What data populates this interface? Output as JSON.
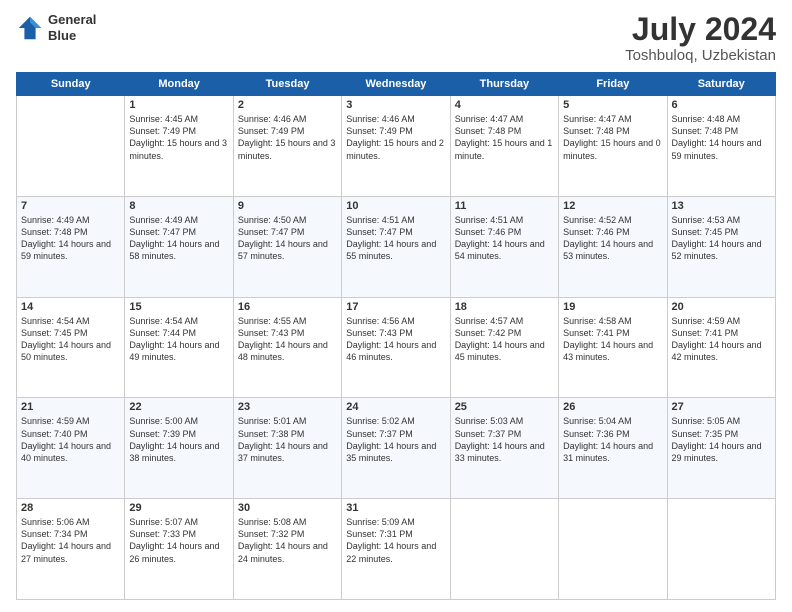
{
  "header": {
    "logo_line1": "General",
    "logo_line2": "Blue",
    "main_title": "July 2024",
    "subtitle": "Toshbuloq, Uzbekistan"
  },
  "days_of_week": [
    "Sunday",
    "Monday",
    "Tuesday",
    "Wednesday",
    "Thursday",
    "Friday",
    "Saturday"
  ],
  "weeks": [
    [
      {
        "day": "",
        "sunrise": "",
        "sunset": "",
        "daylight": ""
      },
      {
        "day": "1",
        "sunrise": "Sunrise: 4:45 AM",
        "sunset": "Sunset: 7:49 PM",
        "daylight": "Daylight: 15 hours and 3 minutes."
      },
      {
        "day": "2",
        "sunrise": "Sunrise: 4:46 AM",
        "sunset": "Sunset: 7:49 PM",
        "daylight": "Daylight: 15 hours and 3 minutes."
      },
      {
        "day": "3",
        "sunrise": "Sunrise: 4:46 AM",
        "sunset": "Sunset: 7:49 PM",
        "daylight": "Daylight: 15 hours and 2 minutes."
      },
      {
        "day": "4",
        "sunrise": "Sunrise: 4:47 AM",
        "sunset": "Sunset: 7:48 PM",
        "daylight": "Daylight: 15 hours and 1 minute."
      },
      {
        "day": "5",
        "sunrise": "Sunrise: 4:47 AM",
        "sunset": "Sunset: 7:48 PM",
        "daylight": "Daylight: 15 hours and 0 minutes."
      },
      {
        "day": "6",
        "sunrise": "Sunrise: 4:48 AM",
        "sunset": "Sunset: 7:48 PM",
        "daylight": "Daylight: 14 hours and 59 minutes."
      }
    ],
    [
      {
        "day": "7",
        "sunrise": "Sunrise: 4:49 AM",
        "sunset": "Sunset: 7:48 PM",
        "daylight": "Daylight: 14 hours and 59 minutes."
      },
      {
        "day": "8",
        "sunrise": "Sunrise: 4:49 AM",
        "sunset": "Sunset: 7:47 PM",
        "daylight": "Daylight: 14 hours and 58 minutes."
      },
      {
        "day": "9",
        "sunrise": "Sunrise: 4:50 AM",
        "sunset": "Sunset: 7:47 PM",
        "daylight": "Daylight: 14 hours and 57 minutes."
      },
      {
        "day": "10",
        "sunrise": "Sunrise: 4:51 AM",
        "sunset": "Sunset: 7:47 PM",
        "daylight": "Daylight: 14 hours and 55 minutes."
      },
      {
        "day": "11",
        "sunrise": "Sunrise: 4:51 AM",
        "sunset": "Sunset: 7:46 PM",
        "daylight": "Daylight: 14 hours and 54 minutes."
      },
      {
        "day": "12",
        "sunrise": "Sunrise: 4:52 AM",
        "sunset": "Sunset: 7:46 PM",
        "daylight": "Daylight: 14 hours and 53 minutes."
      },
      {
        "day": "13",
        "sunrise": "Sunrise: 4:53 AM",
        "sunset": "Sunset: 7:45 PM",
        "daylight": "Daylight: 14 hours and 52 minutes."
      }
    ],
    [
      {
        "day": "14",
        "sunrise": "Sunrise: 4:54 AM",
        "sunset": "Sunset: 7:45 PM",
        "daylight": "Daylight: 14 hours and 50 minutes."
      },
      {
        "day": "15",
        "sunrise": "Sunrise: 4:54 AM",
        "sunset": "Sunset: 7:44 PM",
        "daylight": "Daylight: 14 hours and 49 minutes."
      },
      {
        "day": "16",
        "sunrise": "Sunrise: 4:55 AM",
        "sunset": "Sunset: 7:43 PM",
        "daylight": "Daylight: 14 hours and 48 minutes."
      },
      {
        "day": "17",
        "sunrise": "Sunrise: 4:56 AM",
        "sunset": "Sunset: 7:43 PM",
        "daylight": "Daylight: 14 hours and 46 minutes."
      },
      {
        "day": "18",
        "sunrise": "Sunrise: 4:57 AM",
        "sunset": "Sunset: 7:42 PM",
        "daylight": "Daylight: 14 hours and 45 minutes."
      },
      {
        "day": "19",
        "sunrise": "Sunrise: 4:58 AM",
        "sunset": "Sunset: 7:41 PM",
        "daylight": "Daylight: 14 hours and 43 minutes."
      },
      {
        "day": "20",
        "sunrise": "Sunrise: 4:59 AM",
        "sunset": "Sunset: 7:41 PM",
        "daylight": "Daylight: 14 hours and 42 minutes."
      }
    ],
    [
      {
        "day": "21",
        "sunrise": "Sunrise: 4:59 AM",
        "sunset": "Sunset: 7:40 PM",
        "daylight": "Daylight: 14 hours and 40 minutes."
      },
      {
        "day": "22",
        "sunrise": "Sunrise: 5:00 AM",
        "sunset": "Sunset: 7:39 PM",
        "daylight": "Daylight: 14 hours and 38 minutes."
      },
      {
        "day": "23",
        "sunrise": "Sunrise: 5:01 AM",
        "sunset": "Sunset: 7:38 PM",
        "daylight": "Daylight: 14 hours and 37 minutes."
      },
      {
        "day": "24",
        "sunrise": "Sunrise: 5:02 AM",
        "sunset": "Sunset: 7:37 PM",
        "daylight": "Daylight: 14 hours and 35 minutes."
      },
      {
        "day": "25",
        "sunrise": "Sunrise: 5:03 AM",
        "sunset": "Sunset: 7:37 PM",
        "daylight": "Daylight: 14 hours and 33 minutes."
      },
      {
        "day": "26",
        "sunrise": "Sunrise: 5:04 AM",
        "sunset": "Sunset: 7:36 PM",
        "daylight": "Daylight: 14 hours and 31 minutes."
      },
      {
        "day": "27",
        "sunrise": "Sunrise: 5:05 AM",
        "sunset": "Sunset: 7:35 PM",
        "daylight": "Daylight: 14 hours and 29 minutes."
      }
    ],
    [
      {
        "day": "28",
        "sunrise": "Sunrise: 5:06 AM",
        "sunset": "Sunset: 7:34 PM",
        "daylight": "Daylight: 14 hours and 27 minutes."
      },
      {
        "day": "29",
        "sunrise": "Sunrise: 5:07 AM",
        "sunset": "Sunset: 7:33 PM",
        "daylight": "Daylight: 14 hours and 26 minutes."
      },
      {
        "day": "30",
        "sunrise": "Sunrise: 5:08 AM",
        "sunset": "Sunset: 7:32 PM",
        "daylight": "Daylight: 14 hours and 24 minutes."
      },
      {
        "day": "31",
        "sunrise": "Sunrise: 5:09 AM",
        "sunset": "Sunset: 7:31 PM",
        "daylight": "Daylight: 14 hours and 22 minutes."
      },
      {
        "day": "",
        "sunrise": "",
        "sunset": "",
        "daylight": ""
      },
      {
        "day": "",
        "sunrise": "",
        "sunset": "",
        "daylight": ""
      },
      {
        "day": "",
        "sunrise": "",
        "sunset": "",
        "daylight": ""
      }
    ]
  ]
}
